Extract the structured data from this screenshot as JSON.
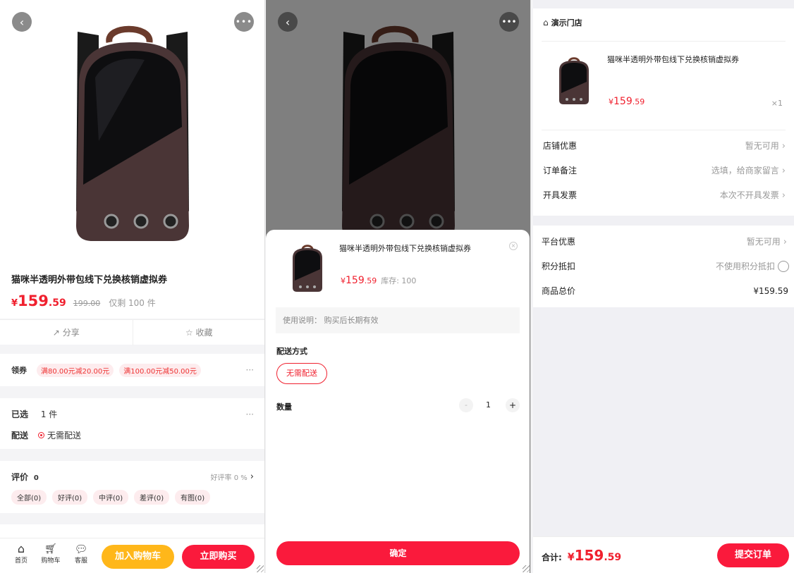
{
  "product": {
    "title": "猫咪半透明外带包线下兑换核销虚拟券",
    "currency": "¥",
    "price_int": "159",
    "price_dec": ".59",
    "price_full": "159.59",
    "original_price": "199.00",
    "stock_note": "仅剩 100 件"
  },
  "detail": {
    "share_label": "分享",
    "favorite_label": "收藏",
    "coupon_label": "领券",
    "coupons": [
      "满80.00元减20.00元",
      "满100.00元减50.00元"
    ],
    "more": "···",
    "selected_label": "已选",
    "selected_value": "1 件",
    "delivery_label": "配送",
    "delivery_value": "无需配送",
    "review_label": "评价",
    "review_count": "0",
    "good_rate": "好评率 0 %",
    "review_tags": [
      "全部(0)",
      "好评(0)",
      "中评(0)",
      "差评(0)",
      "有图(0)"
    ],
    "nav": [
      {
        "label": "首页",
        "icon": "home-icon"
      },
      {
        "label": "购物车",
        "icon": "cart-icon"
      },
      {
        "label": "客服",
        "icon": "chat-icon"
      }
    ],
    "add_cart": "加入购物车",
    "buy_now": "立即购买"
  },
  "sheet": {
    "stock_label": "库存: 100",
    "usage_label": "使用说明：",
    "usage_value": "购买后长期有效",
    "delivery_method_label": "配送方式",
    "delivery_option": "无需配送",
    "qty_label": "数量",
    "qty_value": "1",
    "minus": "-",
    "plus": "+",
    "confirm": "确定"
  },
  "order": {
    "store_name": "演示门店",
    "qty": "×1",
    "rows1": [
      {
        "label": "店铺优惠",
        "value": "暂无可用"
      },
      {
        "label": "订单备注",
        "value": "选填，给商家留言"
      },
      {
        "label": "开具发票",
        "value": "本次不开具发票"
      }
    ],
    "platform_label": "平台优惠",
    "platform_value": "暂无可用",
    "points_label": "积分抵扣",
    "points_value": "不使用积分抵扣",
    "total_label": "商品总价",
    "total_value": "¥159.59",
    "sum_label": "合计:",
    "submit": "提交订单"
  },
  "colors": {
    "accent": "#fa1a3c",
    "price": "#f0202e",
    "yellow": "#ffb71a"
  }
}
